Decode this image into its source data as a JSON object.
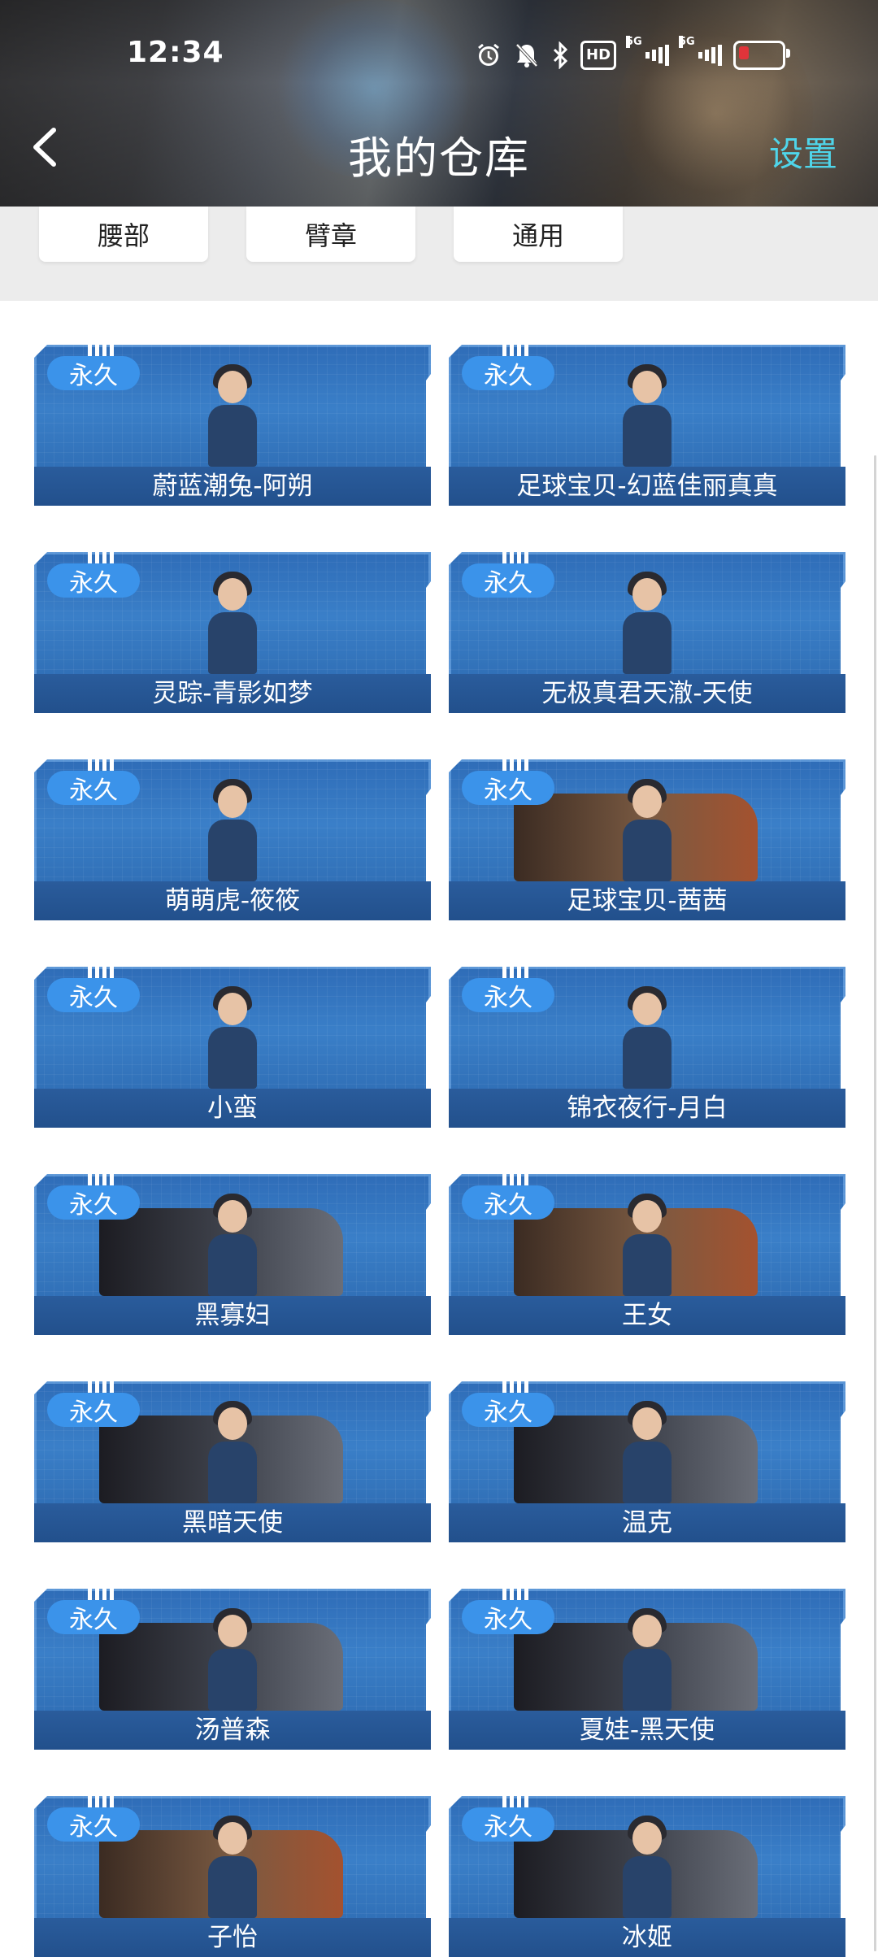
{
  "status_bar": {
    "time": "12:34",
    "icons": [
      "alarm-icon",
      "mute-icon",
      "bluetooth-icon",
      "hd-icon",
      "signal-5g-icon",
      "signal-5g-icon",
      "battery-low-icon"
    ],
    "hd_label": "HD",
    "network_label_1": "5G",
    "network_label_2": "5G",
    "battery_level": 0.15,
    "battery_color": "#e0343a"
  },
  "header": {
    "title": "我的仓库",
    "settings_label": "设置",
    "settings_color": "#4fd5ea"
  },
  "filters": [
    {
      "label": "腰部"
    },
    {
      "label": "臂章"
    },
    {
      "label": "通用"
    }
  ],
  "items": [
    {
      "badge": "永久",
      "name": "蔚蓝潮兔-阿朔"
    },
    {
      "badge": "永久",
      "name": "足球宝贝-幻蓝佳丽真真"
    },
    {
      "badge": "永久",
      "name": "灵踪-青影如梦"
    },
    {
      "badge": "永久",
      "name": "无极真君天澈-天使"
    },
    {
      "badge": "永久",
      "name": "萌萌虎-筱筱"
    },
    {
      "badge": "永久",
      "name": "足球宝贝-茜茜"
    },
    {
      "badge": "永久",
      "name": "小蛮"
    },
    {
      "badge": "永久",
      "name": "锦衣夜行-月白"
    },
    {
      "badge": "永久",
      "name": "黑寡妇"
    },
    {
      "badge": "永久",
      "name": "王女"
    },
    {
      "badge": "永久",
      "name": "黑暗天使"
    },
    {
      "badge": "永久",
      "name": "温克"
    },
    {
      "badge": "永久",
      "name": "汤普森"
    },
    {
      "badge": "永久",
      "name": "夏娃-黑天使"
    },
    {
      "badge": "永久",
      "name": "子怡"
    },
    {
      "badge": "永久",
      "name": "冰姬"
    }
  ],
  "colors": {
    "card_blue": "#3a7fc8",
    "badge_blue": "#3b93ea",
    "filter_bg": "#ececec"
  }
}
